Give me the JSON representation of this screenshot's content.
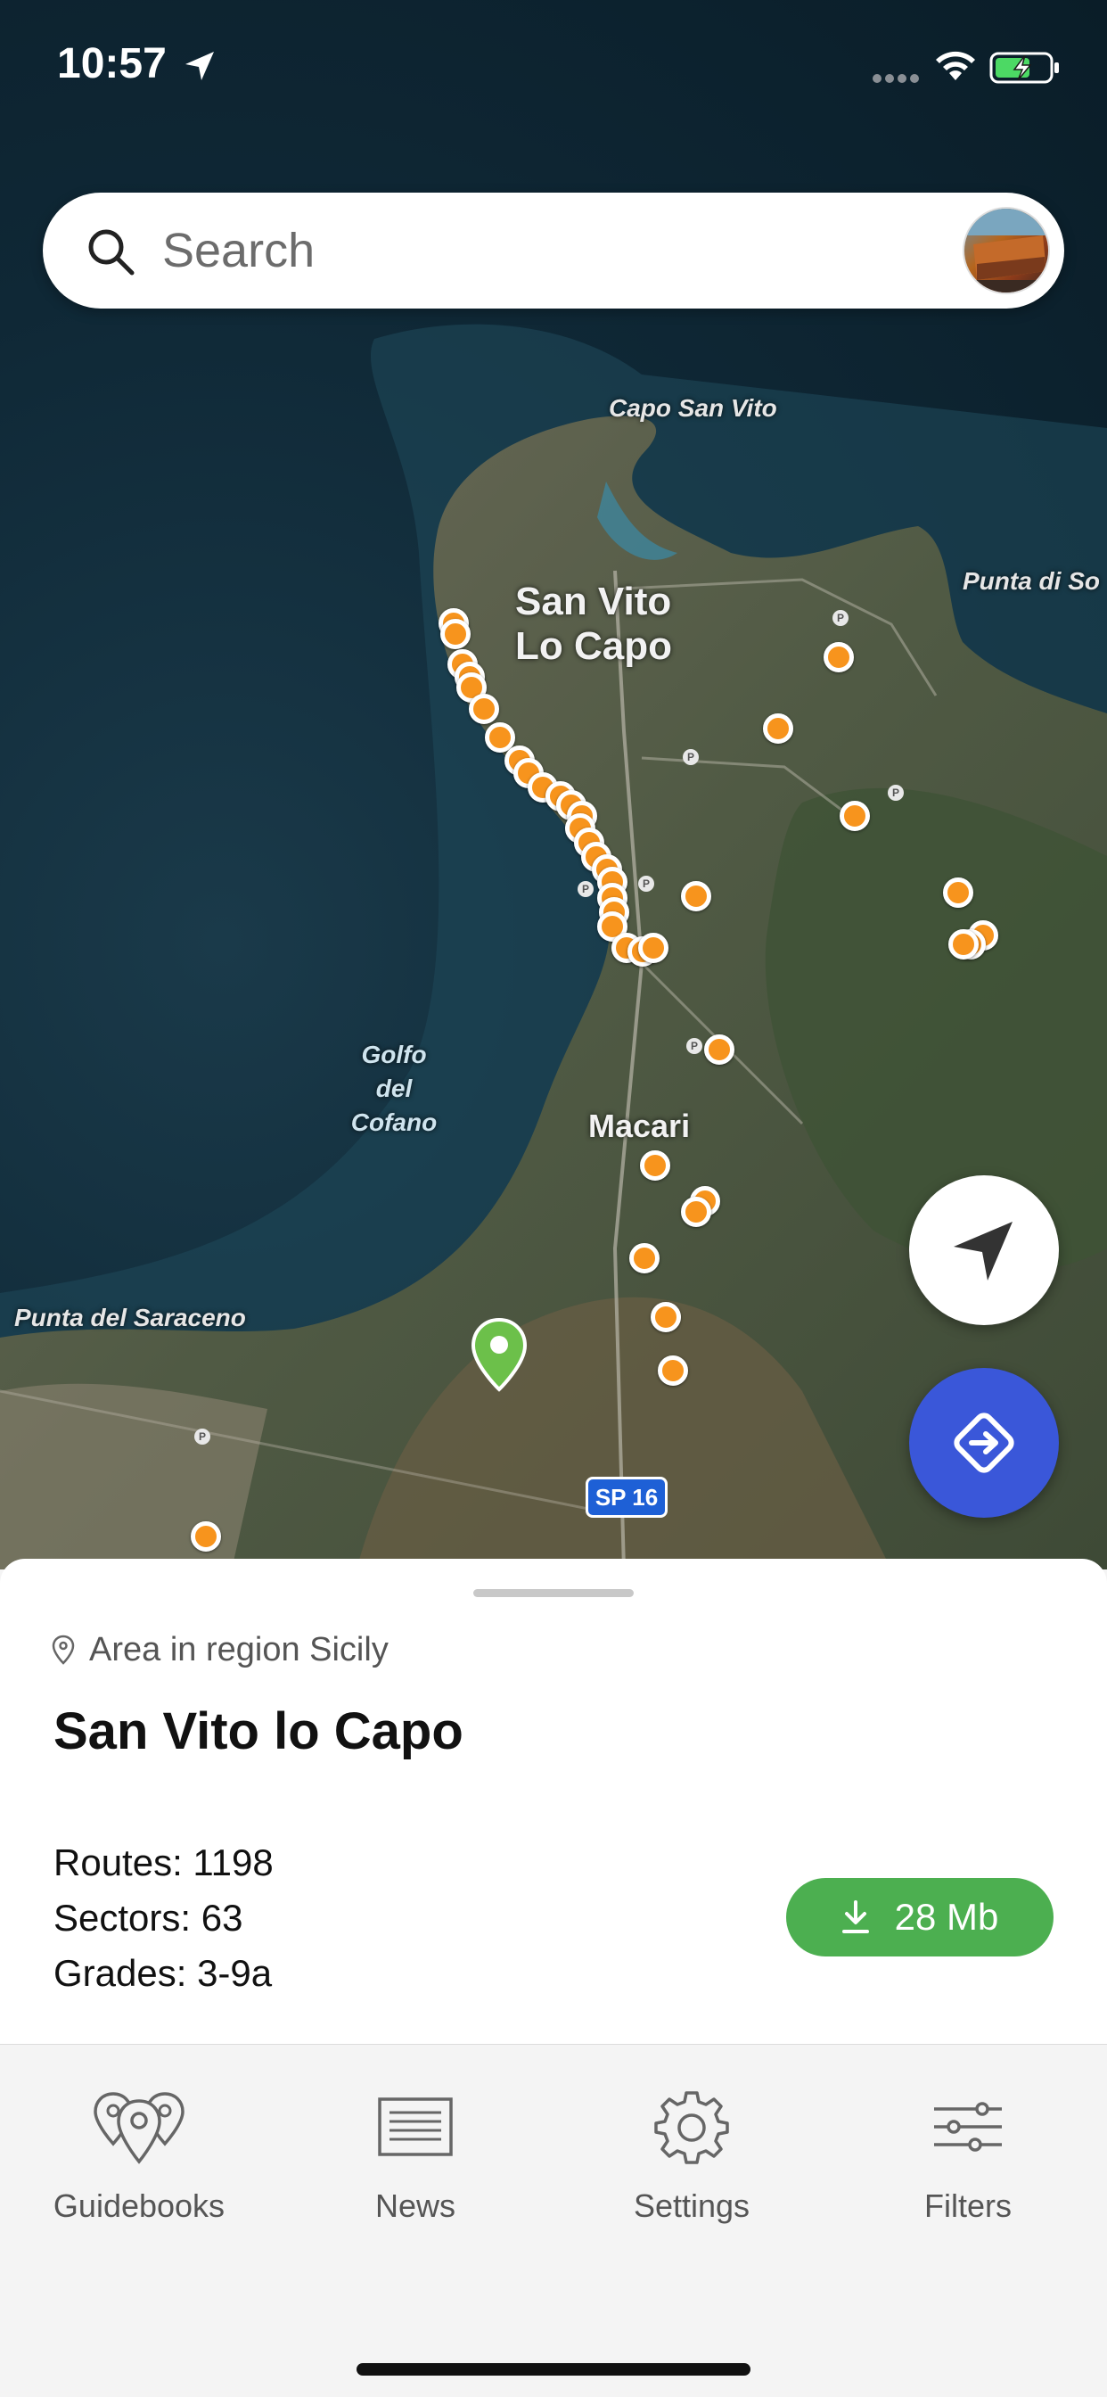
{
  "status_bar": {
    "time": "10:57"
  },
  "search": {
    "placeholder": "Search"
  },
  "map": {
    "labels": {
      "capo_san_vito": "Capo San Vito",
      "punta_di_so": "Punta di So",
      "town_line1": "San Vito",
      "town_line2": "Lo Capo",
      "golfo_line1": "Golfo",
      "golfo_line2": "del",
      "golfo_line3": "Cofano",
      "macari": "Macari",
      "punta_del_saraceno": "Punta del Saraceno",
      "road": "SP 16",
      "parking": "P"
    }
  },
  "sheet": {
    "region": "Area in region Sicily",
    "title": "San Vito lo Capo",
    "routes": "Routes: 1198",
    "sectors": "Sectors: 63",
    "grades": "Grades: 3-9a",
    "download_label": "28 Mb"
  },
  "tabs": {
    "guidebooks": "Guidebooks",
    "news": "News",
    "settings": "Settings",
    "filters": "Filters"
  },
  "colors": {
    "pin": "#f7941d",
    "selected_pin": "#6cc04a",
    "route_button": "#3a57d9",
    "download_button": "#4caf50",
    "road_badge": "#1e60d6"
  }
}
